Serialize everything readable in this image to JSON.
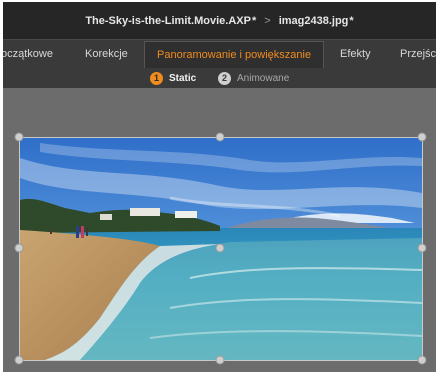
{
  "title_bar": {
    "project": "The-Sky-is-the-Limit.Movie.AXP",
    "project_modified": "*",
    "separator": ">",
    "file": "imag2438.jpg",
    "file_modified": "*"
  },
  "tabs": [
    {
      "label": "oczątkowe"
    },
    {
      "label": "Korekcje"
    },
    {
      "label": "Panoramowanie i powiększanie",
      "active": true
    },
    {
      "label": "Efekty"
    },
    {
      "label": "Przejści"
    }
  ],
  "subtabs": [
    {
      "number": "1",
      "label": "Static",
      "active": true
    },
    {
      "number": "2",
      "label": "Animowane",
      "active": false
    }
  ],
  "colors": {
    "accent": "#f08c1e",
    "titlebar_bg": "#262626",
    "tabbar_bg": "#3a3a3a",
    "canvas_bg": "#6c6c6c"
  },
  "preview": {
    "description_icon": "image-preview"
  }
}
